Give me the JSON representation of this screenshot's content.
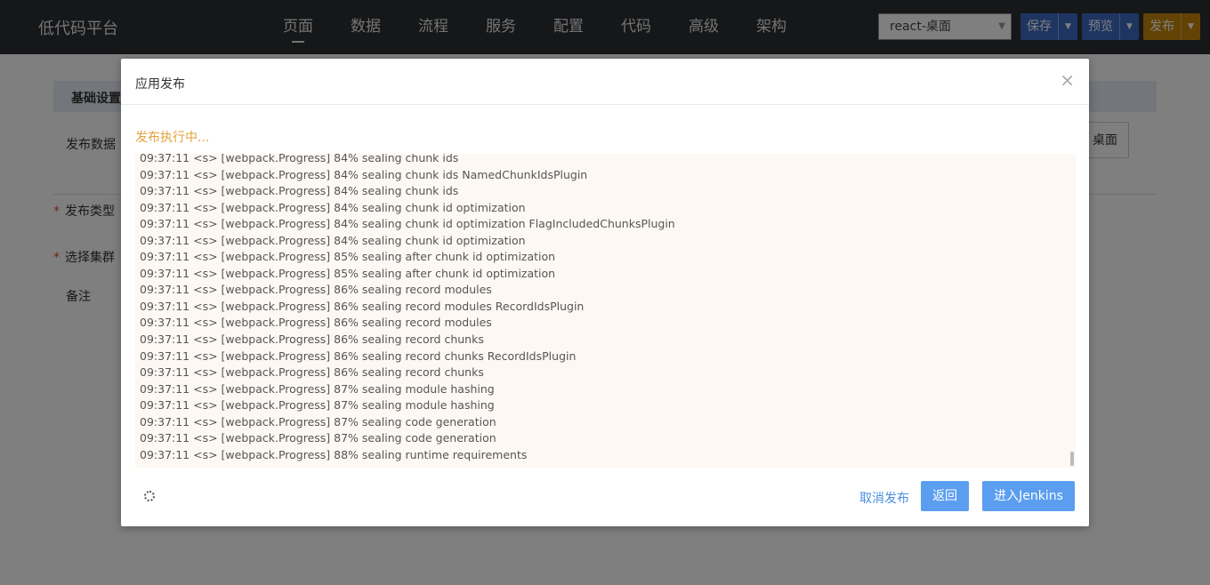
{
  "app": {
    "brand": "低代码平台"
  },
  "nav": {
    "items": [
      "页面",
      "数据",
      "流程",
      "服务",
      "配置",
      "代码",
      "高级",
      "架构"
    ],
    "active": "页面"
  },
  "toolbar": {
    "env_value": "react-桌面",
    "save_label": "保存",
    "preview_label": "预览",
    "publish_label": "发布"
  },
  "background": {
    "section_title": "基础设置",
    "labels": {
      "data": "发布数据",
      "type": "发布类型",
      "cluster": "选择集群",
      "remark": "备注"
    },
    "right_button": "桌面"
  },
  "modal": {
    "title": "应用发布",
    "status": "发布执行中...",
    "cancel_label": "取消发布",
    "back_label": "返回",
    "jenkins_label": "进入Jenkins",
    "log": [
      "09:37:11 <s> [webpack.Progress] 84% sealing chunk ids",
      "09:37:11 <s> [webpack.Progress] 84% sealing chunk ids NamedChunkIdsPlugin",
      "09:37:11 <s> [webpack.Progress] 84% sealing chunk ids",
      "09:37:11 <s> [webpack.Progress] 84% sealing chunk id optimization",
      "09:37:11 <s> [webpack.Progress] 84% sealing chunk id optimization FlagIncludedChunksPlugin",
      "09:37:11 <s> [webpack.Progress] 84% sealing chunk id optimization",
      "09:37:11 <s> [webpack.Progress] 85% sealing after chunk id optimization",
      "09:37:11 <s> [webpack.Progress] 85% sealing after chunk id optimization",
      "09:37:11 <s> [webpack.Progress] 86% sealing record modules",
      "09:37:11 <s> [webpack.Progress] 86% sealing record modules RecordIdsPlugin",
      "09:37:11 <s> [webpack.Progress] 86% sealing record modules",
      "09:37:11 <s> [webpack.Progress] 86% sealing record chunks",
      "09:37:11 <s> [webpack.Progress] 86% sealing record chunks RecordIdsPlugin",
      "09:37:11 <s> [webpack.Progress] 86% sealing record chunks",
      "09:37:11 <s> [webpack.Progress] 87% sealing module hashing",
      "09:37:11 <s> [webpack.Progress] 87% sealing module hashing",
      "09:37:11 <s> [webpack.Progress] 87% sealing code generation",
      "09:37:11 <s> [webpack.Progress] 87% sealing code generation",
      "09:37:11 <s> [webpack.Progress] 88% sealing runtime requirements"
    ]
  }
}
